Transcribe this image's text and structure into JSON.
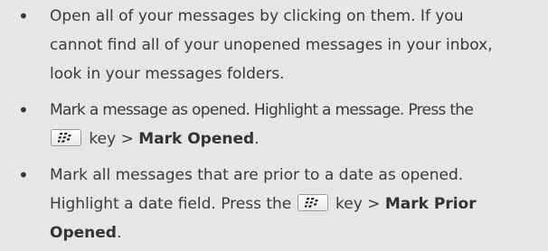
{
  "bullet_symbol": "•",
  "items": [
    {
      "lines": [
        "Open all of your messages by clicking on them. If you",
        "cannot find all of your unopened messages in your inbox,",
        "look in your messages folders."
      ]
    },
    {
      "lines": [
        "Mark a message as opened. Highlight a message. Press the"
      ],
      "key_before": "",
      "key_after": " key > ",
      "command": "Mark Opened",
      "end": "."
    },
    {
      "lines": [
        "Mark all messages that are prior to a date as opened."
      ],
      "key_before": "Highlight a date field. Press the ",
      "key_after": " key > ",
      "command_part1": "Mark Prior",
      "command_part2": "Opened",
      "end": "."
    }
  ],
  "icons": {
    "menu_key": "blackberry-menu-key-icon"
  }
}
